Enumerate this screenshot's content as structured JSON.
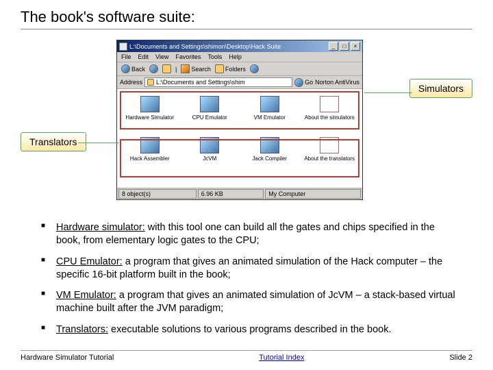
{
  "title": "The book's software suite:",
  "callouts": {
    "simulators": "Simulators",
    "translators": "Translators"
  },
  "explorer": {
    "titlebar": "L:\\Documents and Settings\\shimon\\Desktop\\Hack Suite",
    "menus": [
      "File",
      "Edit",
      "View",
      "Favorites",
      "Tools",
      "Help"
    ],
    "buttons": {
      "back": "Back",
      "search": "Search",
      "folders": "Folders"
    },
    "address_label": "Address",
    "address_value": "L:\\Documents and Settings\\shim",
    "go": "Go",
    "norton": "Norton AntiVirus",
    "items_row1": [
      "Hardware Simulator",
      "CPU Emulator",
      "VM Emulator",
      "About the simulators"
    ],
    "items_row2": [
      "Hack Assembler",
      "JcVM",
      "Jack Compiler",
      "About the translators"
    ],
    "status_objects": "8 object(s)",
    "status_size": "6.96 KB",
    "status_loc": "My Computer"
  },
  "bullets": [
    {
      "term": "Hardware simulator:",
      "rest": " with this tool one can build all the gates and chips specified in the book, from elementary logic gates to the CPU;"
    },
    {
      "term": "CPU Emulator:",
      "rest": " a program that gives an animated simulation of the Hack computer – the specific 16-bit platform built in the book;"
    },
    {
      "term": "VM Emulator:",
      "rest": " a program that gives an animated simulation of JcVM – a stack-based virtual machine built after the JVM paradigm;"
    },
    {
      "term": "Translators:",
      "rest": " executable solutions to various programs described in the book."
    }
  ],
  "footer": {
    "left": "Hardware Simulator Tutorial",
    "mid": "Tutorial Index",
    "right": "Slide 2"
  }
}
